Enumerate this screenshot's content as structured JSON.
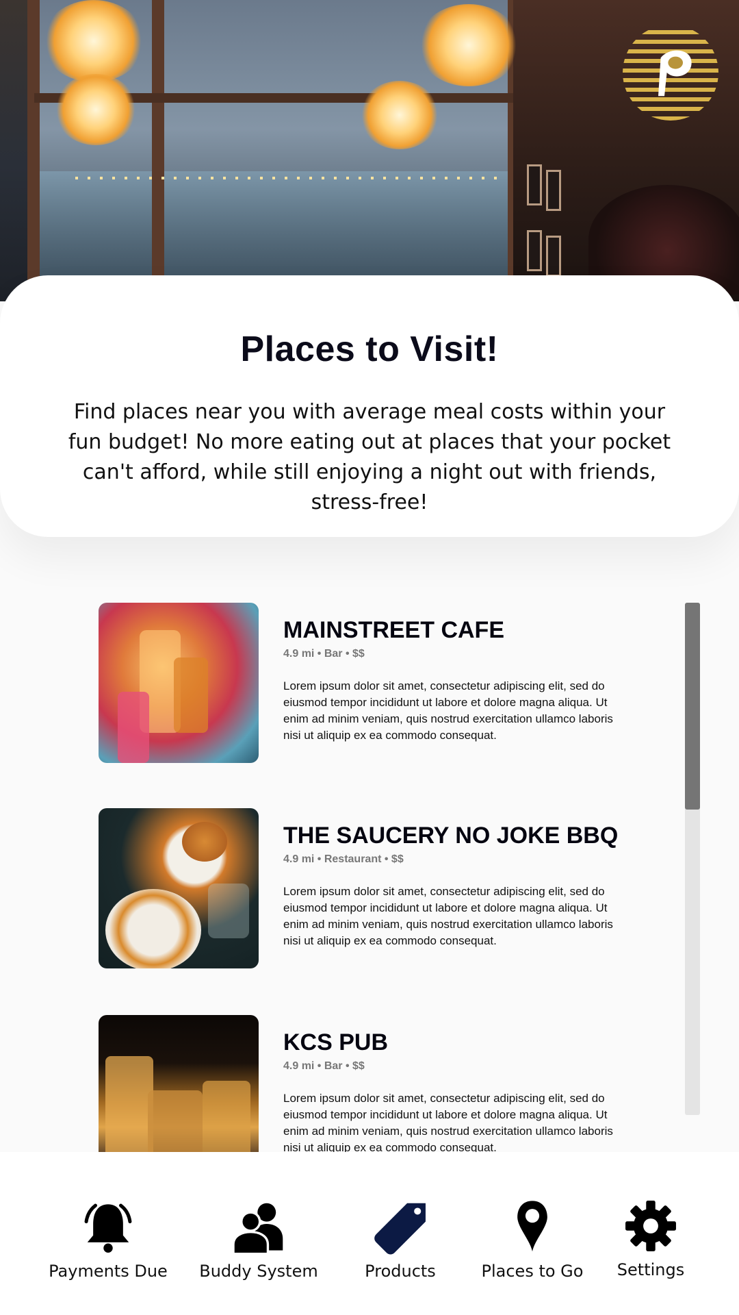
{
  "app": {
    "logo_icon": "p-logo-icon",
    "accent_color": "#d9b44a"
  },
  "intro": {
    "title": "Places to Visit!",
    "description": "Find places near you with average meal costs within your fun budget! No more eating out at places that your pocket can't afford, while still enjoying a night out with friends, stress-free!"
  },
  "places": [
    {
      "name": "MAINSTREET CAFE",
      "meta": "4.9 mi • Bar • $$",
      "description": "Lorem ipsum dolor sit amet, consectetur adipiscing elit, sed do eiusmod tempor incididunt ut labore et dolore magna aliqua. Ut enim ad minim veniam, quis nostrud exercitation ullamco laboris nisi ut aliquip ex ea commodo consequat."
    },
    {
      "name": "THE SAUCERY NO JOKE BBQ",
      "meta": "4.9 mi • Restaurant • $$",
      "description": "Lorem ipsum dolor sit amet, consectetur adipiscing elit, sed do eiusmod tempor incididunt ut labore et dolore magna aliqua. Ut enim ad minim veniam, quis nostrud exercitation ullamco laboris nisi ut aliquip ex ea commodo consequat."
    },
    {
      "name": "KCS PUB",
      "meta": "4.9 mi • Bar • $$",
      "description": "Lorem ipsum dolor sit amet, consectetur adipiscing elit, sed do eiusmod tempor incididunt ut labore et dolore magna aliqua. Ut enim ad minim veniam, quis nostrud exercitation ullamco laboris nisi ut aliquip ex ea commodo consequat."
    }
  ],
  "nav": [
    {
      "label": "Payments Due",
      "icon": "bell-icon"
    },
    {
      "label": "Buddy System",
      "icon": "users-icon"
    },
    {
      "label": "Products",
      "icon": "tag-icon"
    },
    {
      "label": "Places to Go",
      "icon": "map-pin-icon"
    },
    {
      "label": "Settings",
      "icon": "gear-icon"
    }
  ]
}
